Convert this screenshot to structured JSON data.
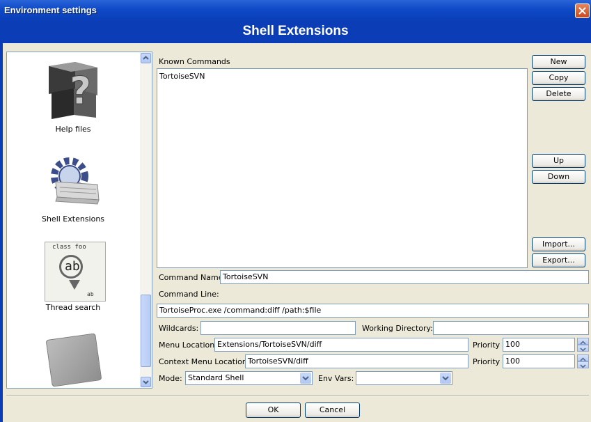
{
  "window": {
    "title": "Environment settings"
  },
  "header": {
    "title": "Shell Extensions"
  },
  "sidebar": {
    "items": [
      {
        "label": "Help files",
        "icon": "help-files-icon"
      },
      {
        "label": "Shell Extensions",
        "icon": "shell-extensions-icon"
      },
      {
        "label": "Thread search",
        "icon": "thread-search-icon"
      },
      {
        "label": "",
        "icon": "notes-icon"
      }
    ],
    "thread_icon_text": {
      "line1": "class foo",
      "line2": "ab",
      "line3": "ab"
    }
  },
  "known_commands": {
    "label": "Known Commands",
    "items": [
      "TortoiseSVN"
    ]
  },
  "buttons": {
    "new": "New",
    "copy": "Copy",
    "delete": "Delete",
    "up": "Up",
    "down": "Down",
    "import": "Import...",
    "export": "Export..."
  },
  "form": {
    "command_name_label": "Command Name:",
    "command_name": "TortoiseSVN",
    "command_line_label": "Command Line:",
    "command_line": "TortoiseProc.exe /command:diff /path:$file",
    "wildcards_label": "Wildcards:",
    "wildcards": "",
    "working_dir_label": "Working Directory:",
    "working_dir": "",
    "menu_location_label": "Menu Location",
    "menu_location": "Extensions/TortoiseSVN/diff",
    "priority_label": "Priority",
    "menu_priority": "100",
    "context_menu_label": "Context Menu Location",
    "context_menu_location": "TortoiseSVN/diff",
    "context_priority": "100",
    "mode_label": "Mode:",
    "mode": "Standard Shell",
    "env_vars_label": "Env Vars:",
    "env_vars": ""
  },
  "footer": {
    "ok": "OK",
    "cancel": "Cancel"
  }
}
